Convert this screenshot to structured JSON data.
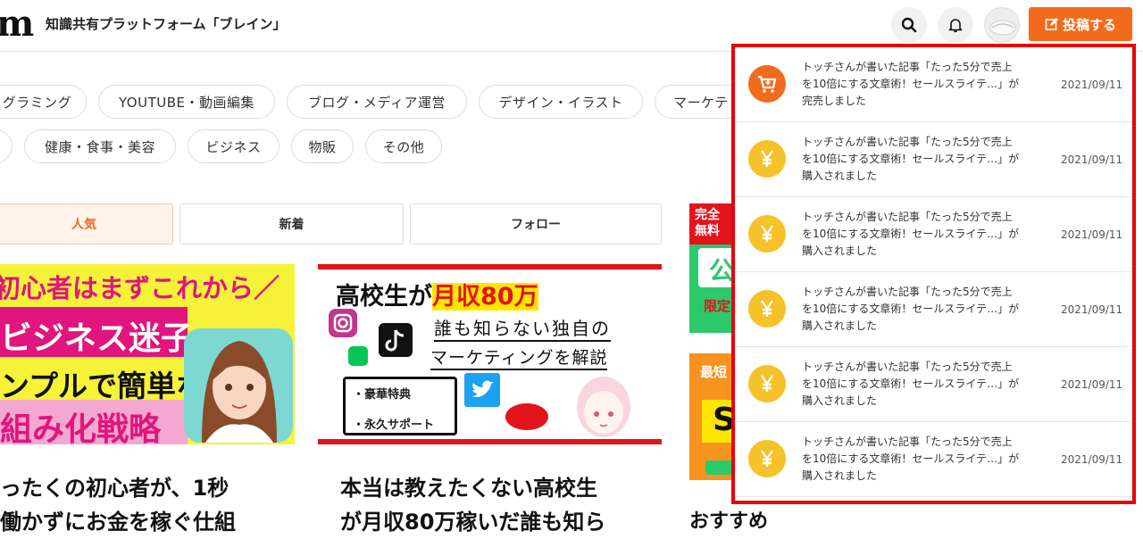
{
  "header": {
    "logo": "m",
    "site_title": "知識共有プラットフォーム「ブレイン」",
    "post_label": "投稿する"
  },
  "categories": {
    "row1": [
      "グラミング",
      "YOUTUBE・動画編集",
      "ブログ・メディア運営",
      "デザイン・イラスト",
      "マーケテ"
    ],
    "row2": [
      "健康・食事・美容",
      "ビジネス",
      "物販",
      "その他"
    ]
  },
  "tabs": [
    "人気",
    "新着",
    "フォロー"
  ],
  "cards": [
    {
      "thumb_lines": [
        "初心者はまずこれから／",
        "ビジネス迷子",
        "ンプルで簡単な",
        "組み化戦略"
      ],
      "title_lines": [
        "ったくの初心者が、1秒",
        "働かずにお金を稼ぐ仕組"
      ]
    },
    {
      "thumb_title": "高校生が",
      "thumb_highlight": "月収80万",
      "thumb_sub1": "誰も知らない独自の",
      "thumb_sub2": "マーケティングを解説",
      "thumb_bullet1": "・豪華特典",
      "thumb_bullet2": "・永久サポート",
      "title_lines": [
        "本当は教えたくない高校生",
        "が月収80万稼いだ誰も知ら"
      ]
    }
  ],
  "side": {
    "banner1_top": "完全",
    "banner1_mid": "無料",
    "banner1_big": "公",
    "banner1_bottom": "限定",
    "banner2_top": "最短",
    "banner2_big": "S",
    "recommend_label": "おすすめ"
  },
  "notifications": [
    {
      "icon": "cart-icon",
      "color": "#f26b1d",
      "line1": "トッチさんが書いた記事「たった5分で売上",
      "line2": "を10倍にする文章術！セールスライテ…」が",
      "line3": "完売しました",
      "date": "2021/09/11"
    },
    {
      "icon": "yen-icon",
      "color": "#f5c22a",
      "line1": "トッチさんが書いた記事「たった5分で売上",
      "line2": "を10倍にする文章術！セールスライテ…」が",
      "line3": "購入されました",
      "date": "2021/09/11"
    },
    {
      "icon": "yen-icon",
      "color": "#f5c22a",
      "line1": "トッチさんが書いた記事「たった5分で売上",
      "line2": "を10倍にする文章術！セールスライテ…」が",
      "line3": "購入されました",
      "date": "2021/09/11"
    },
    {
      "icon": "yen-icon",
      "color": "#f5c22a",
      "line1": "トッチさんが書いた記事「たった5分で売上",
      "line2": "を10倍にする文章術！セールスライテ…」が",
      "line3": "購入されました",
      "date": "2021/09/11"
    },
    {
      "icon": "yen-icon",
      "color": "#f5c22a",
      "line1": "トッチさんが書いた記事「たった5分で売上",
      "line2": "を10倍にする文章術！セールスライテ…」が",
      "line3": "購入されました",
      "date": "2021/09/11"
    },
    {
      "icon": "yen-icon",
      "color": "#f5c22a",
      "line1": "トッチさんが書いた記事「たった5分で売上",
      "line2": "を10倍にする文章術！セールスライテ…」が",
      "line3": "購入されました",
      "date": "2021/09/11"
    }
  ],
  "colors": {
    "accent": "#f26b1d",
    "highlight_border": "#e8000b",
    "yen": "#f5c22a"
  }
}
